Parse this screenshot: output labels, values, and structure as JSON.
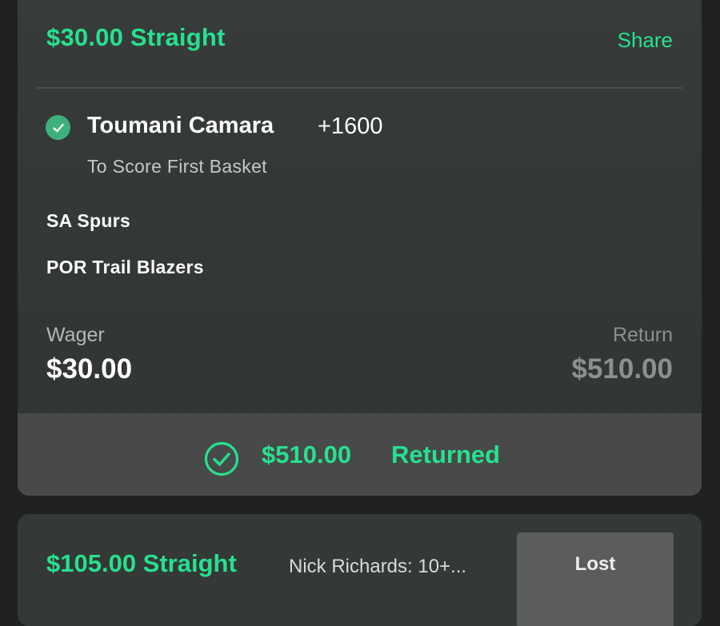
{
  "bet1": {
    "title": "$30.00 Straight",
    "share_label": "Share",
    "selection": {
      "name": "Toumani Camara",
      "odds": "+1600",
      "market": "To Score First Basket",
      "status_icon": "check-circle-filled-icon"
    },
    "teams": [
      "SA Spurs",
      "POR Trail Blazers"
    ],
    "wager_label": "Wager",
    "wager_value": "$30.00",
    "return_label": "Return",
    "return_value": "$510.00",
    "result": {
      "icon": "check-circle-outline-icon",
      "amount": "$510.00",
      "status": "Returned"
    }
  },
  "bet2": {
    "title": "$105.00 Straight",
    "description": "Nick Richards: 10+...",
    "status": "Lost"
  },
  "colors": {
    "accent_green": "#27e08f",
    "check_green": "#3eb07c",
    "card_bg": "#373c3a",
    "result_bar_bg": "#474a49",
    "lost_bg": "#5a5d5c"
  }
}
